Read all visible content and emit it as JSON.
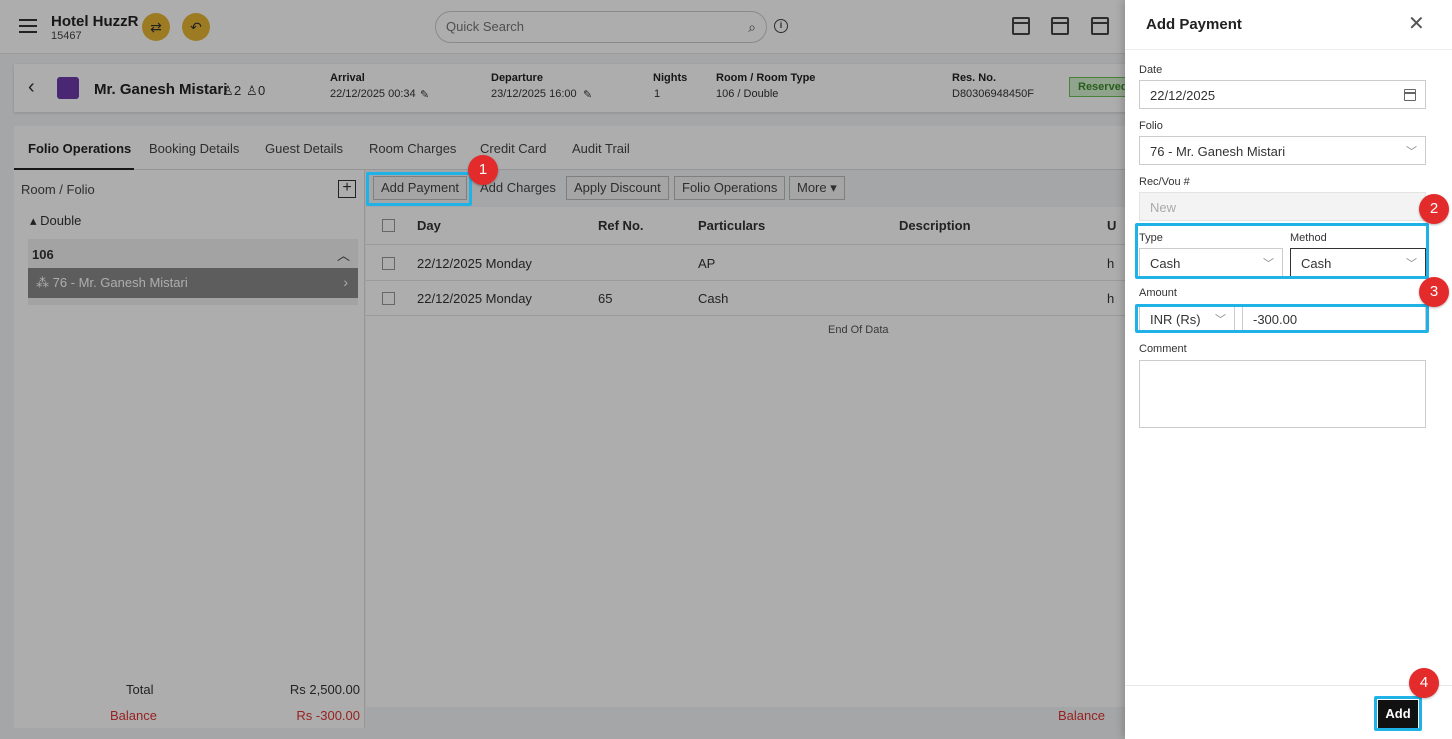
{
  "topbar": {
    "hotel_name": "Hotel HuzzR",
    "hotel_id": "15467",
    "search_placeholder": "Quick Search"
  },
  "guest_bar": {
    "guest_name": "Mr. Ganesh Mistari",
    "adults": "2",
    "children": "0",
    "arrival_label": "Arrival",
    "arrival_value": "22/12/2025 00:34",
    "departure_label": "Departure",
    "departure_value": "23/12/2025 16:00",
    "nights_label": "Nights",
    "nights_value": "1",
    "room_label": "Room / Room Type",
    "room_value": "106 / Double",
    "resno_label": "Res. No.",
    "resno_value": "D80306948450F",
    "status": "Reserved"
  },
  "tabs": [
    "Folio Operations",
    "Booking Details",
    "Guest Details",
    "Room Charges",
    "Credit Card",
    "Audit Trail"
  ],
  "left_panel": {
    "header": "Room / Folio",
    "group": "Double",
    "room": "106",
    "folio": "76 - Mr. Ganesh Mistari",
    "total_label": "Total",
    "total_value": "Rs 2,500.00",
    "balance_label": "Balance",
    "balance_value": "Rs -300.00"
  },
  "toolbar": {
    "add_payment": "Add Payment",
    "add_charges": "Add Charges",
    "apply_discount": "Apply Discount",
    "folio_operations": "Folio Operations",
    "more": "More"
  },
  "grid": {
    "headers": [
      "Day",
      "Ref No.",
      "Particulars",
      "Description",
      "U"
    ],
    "rows": [
      {
        "day": "22/12/2025 Monday",
        "ref": "",
        "particulars": "AP",
        "extra": "h"
      },
      {
        "day": "22/12/2025 Monday",
        "ref": "65",
        "particulars": "Cash",
        "extra": "h"
      }
    ],
    "end_of_data": "End Of Data",
    "balance_label": "Balance"
  },
  "drawer": {
    "title": "Add Payment",
    "date_label": "Date",
    "date_value": "22/12/2025",
    "folio_label": "Folio",
    "folio_value": "76 - Mr. Ganesh Mistari",
    "recvou_label": "Rec/Vou #",
    "recvou_placeholder": "New",
    "type_label": "Type",
    "type_value": "Cash",
    "method_label": "Method",
    "method_value": "Cash",
    "amount_label": "Amount",
    "currency_value": "INR (Rs)",
    "amount_value": "-300.00",
    "comment_label": "Comment",
    "add_button": "Add"
  },
  "annotations": [
    "1",
    "2",
    "3",
    "4"
  ],
  "colors": {
    "highlight": "#1eb2e6",
    "badge": "#e42b2b",
    "accent": "#e8b633",
    "negative": "#dd3333"
  }
}
